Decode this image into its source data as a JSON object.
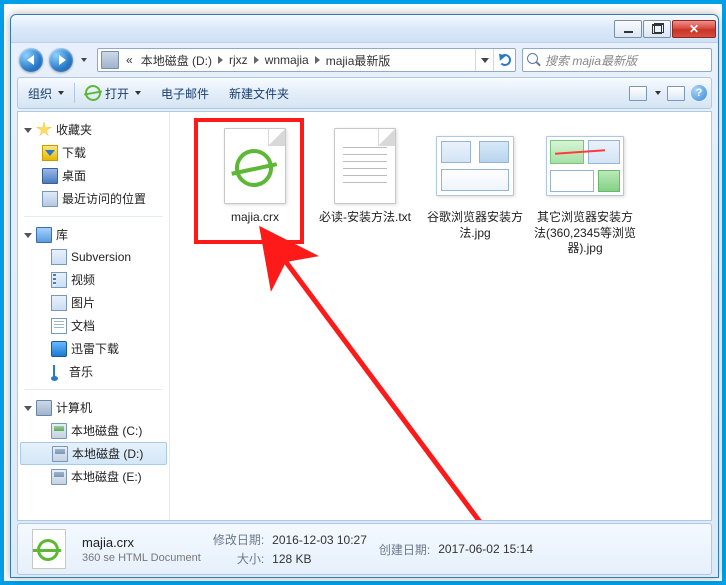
{
  "breadcrumbs": {
    "root_icon": "drive",
    "parts": [
      "本地磁盘 (D:)",
      "rjxz",
      "wnmajia",
      "majia最新版"
    ],
    "prefix": "«"
  },
  "search": {
    "placeholder": "搜索 majia最新版"
  },
  "toolbar": {
    "organize": "组织",
    "open": "打开",
    "email": "电子邮件",
    "new_folder": "新建文件夹"
  },
  "sidebar": {
    "fav": {
      "label": "收藏夹",
      "items": [
        "下载",
        "桌面",
        "最近访问的位置"
      ]
    },
    "lib": {
      "label": "库",
      "items": [
        "Subversion",
        "视频",
        "图片",
        "文档",
        "迅雷下载",
        "音乐"
      ]
    },
    "comp": {
      "label": "计算机",
      "drives": [
        "本地磁盘 (C:)",
        "本地磁盘 (D:)",
        "本地磁盘 (E:)"
      ]
    }
  },
  "files": [
    {
      "name": "majia.crx",
      "selected": true
    },
    {
      "name": "必读-安装方法.txt"
    },
    {
      "name": "谷歌浏览器安装方法.jpg"
    },
    {
      "name": "其它浏览器安装方法(360,2345等浏览器).jpg"
    }
  ],
  "details": {
    "name": "majia.crx",
    "type": "360 se HTML Document",
    "modified_k": "修改日期:",
    "modified_v": "2016-12-03 10:27",
    "created_k": "创建日期:",
    "created_v": "2017-06-02 15:14",
    "size_k": "大小:",
    "size_v": "128 KB"
  },
  "annotation": {
    "highlight_file_index": 0
  }
}
